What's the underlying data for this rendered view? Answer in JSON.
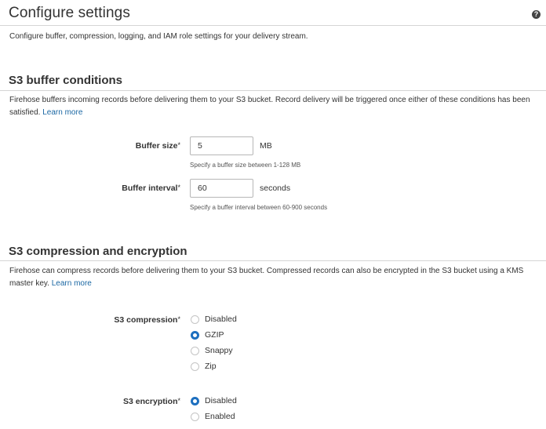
{
  "header": {
    "title": "Configure settings",
    "help_icon": "help-circle-icon",
    "help_glyph": "?",
    "description": "Configure buffer, compression, logging, and IAM role settings for your delivery stream."
  },
  "buffer": {
    "title": "S3 buffer conditions",
    "description": "Firehose buffers incoming records before delivering them to your S3 bucket. Record delivery will be triggered once either of these conditions has been satisfied.",
    "learn_more": "Learn more",
    "size": {
      "label": "Buffer size",
      "required_mark": "*",
      "value": "5",
      "unit": "MB",
      "hint": "Specify a buffer size between 1-128 MB"
    },
    "interval": {
      "label": "Buffer interval",
      "required_mark": "*",
      "value": "60",
      "unit": "seconds",
      "hint": "Specify a buffer interval between 60-900 seconds"
    }
  },
  "compression": {
    "title": "S3 compression and encryption",
    "description": "Firehose can compress records before delivering them to your S3 bucket. Compressed records can also be encrypted in the S3 bucket using a KMS master key.",
    "learn_more": "Learn more",
    "s3_compression": {
      "label": "S3 compression",
      "required_mark": "*",
      "options": [
        "Disabled",
        "GZIP",
        "Snappy",
        "Zip"
      ],
      "selected": "GZIP"
    },
    "s3_encryption": {
      "label": "S3 encryption",
      "required_mark": "*",
      "options": [
        "Disabled",
        "Enabled"
      ],
      "selected": "Disabled"
    }
  },
  "colors": {
    "accent": "#1d6fbf",
    "link": "#1a67a3",
    "rule": "#d5d5d5"
  }
}
